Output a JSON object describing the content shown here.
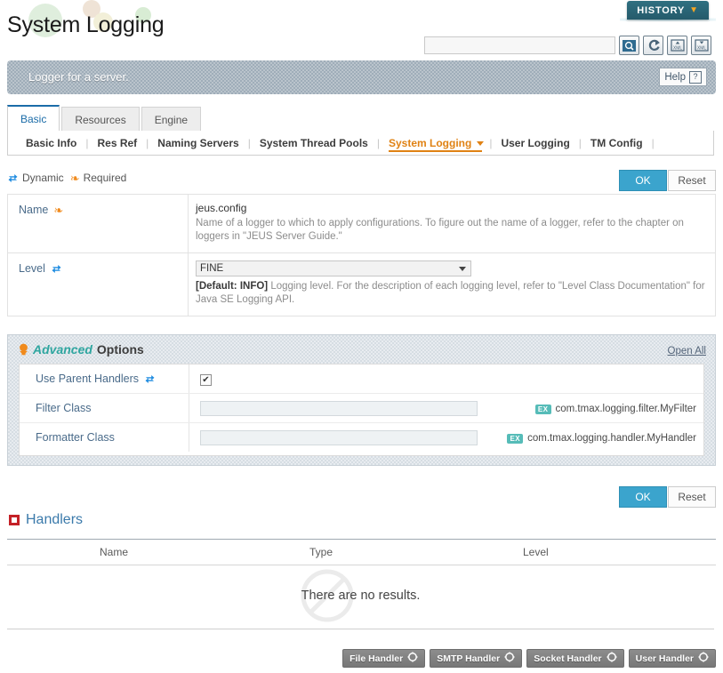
{
  "page": {
    "title": "System Logging",
    "banner_text": "Logger for a server.",
    "help_label": "Help",
    "help_glyph": "?"
  },
  "history": {
    "label": "HISTORY",
    "caret": "▼"
  },
  "search": {
    "value": "",
    "placeholder": "",
    "icons": [
      "search-icon",
      "refresh-icon",
      "xml-import-icon",
      "xml-export-icon"
    ]
  },
  "tabs": [
    {
      "label": "Basic",
      "active": true
    },
    {
      "label": "Resources",
      "active": false
    },
    {
      "label": "Engine",
      "active": false
    }
  ],
  "subnav": [
    {
      "label": "Basic Info",
      "active": false
    },
    {
      "label": "Res Ref",
      "active": false
    },
    {
      "label": "Naming Servers",
      "active": false
    },
    {
      "label": "System Thread Pools",
      "active": false
    },
    {
      "label": "System Logging",
      "active": true
    },
    {
      "label": "User Logging",
      "active": false
    },
    {
      "label": "TM Config",
      "active": false
    }
  ],
  "legend": {
    "dynamic": "Dynamic",
    "required": "Required"
  },
  "actions": {
    "ok": "OK",
    "reset": "Reset"
  },
  "form": {
    "name": {
      "label": "Name",
      "value": "jeus.config",
      "description": "Name of a logger to which to apply configurations. To figure out the name of a logger, refer to the chapter on loggers in \"JEUS Server Guide.\""
    },
    "level": {
      "label": "Level",
      "value": "FINE",
      "default_tag": "[Default: INFO]",
      "description": "Logging level. For the description of each logging level, refer to \"Level Class Documentation\" for Java SE Logging API."
    }
  },
  "advanced": {
    "title_italic": "Advanced",
    "title_plain": "Options",
    "open_all": "Open All",
    "rows": [
      {
        "label": "Use Parent Handlers",
        "type": "checkbox",
        "checked": "✔",
        "example": "",
        "badge": ""
      },
      {
        "label": "Filter Class",
        "type": "text",
        "value": "",
        "badge": "EX",
        "example": "com.tmax.logging.filter.MyFilter"
      },
      {
        "label": "Formatter Class",
        "type": "text",
        "value": "",
        "badge": "EX",
        "example": "com.tmax.logging.handler.MyHandler"
      }
    ]
  },
  "handlers": {
    "title": "Handlers",
    "columns": [
      "Name",
      "Type",
      "Level"
    ],
    "rows": [],
    "empty_message": "There are no results.",
    "buttons": [
      {
        "label": "File Handler"
      },
      {
        "label": "SMTP Handler"
      },
      {
        "label": "Socket Handler"
      },
      {
        "label": "User Handler"
      }
    ]
  },
  "colors": {
    "accent_blue": "#3ba4cd",
    "link_blue": "#4a6b8a",
    "active_orange": "#e08214",
    "teal": "#2fa6a0",
    "banner_gray": "#9fadb9",
    "handler_red": "#c42127"
  }
}
